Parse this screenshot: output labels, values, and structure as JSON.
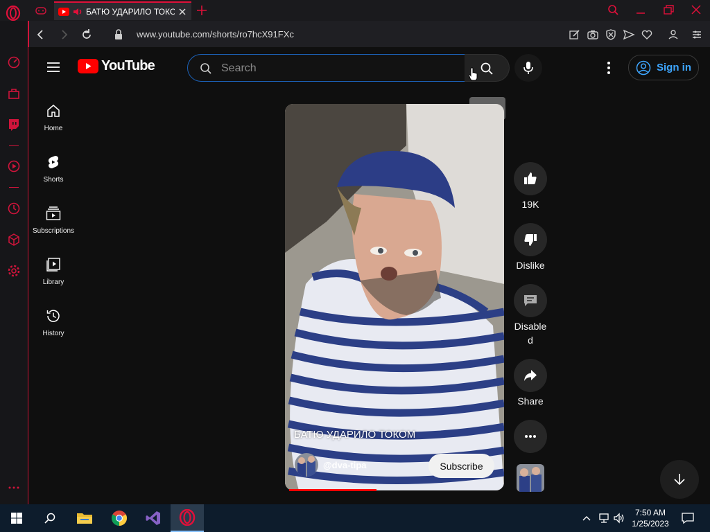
{
  "browser": {
    "tab_title": "БАТЮ УДАРИЛО ТОКОМ",
    "address": "www.youtube.com/shorts/ro7hcX91FXc"
  },
  "youtube": {
    "logo_text": "YouTube",
    "search": {
      "placeholder": "Search",
      "value": ""
    },
    "tooltip": "Search",
    "signin_label": "Sign in",
    "nav": [
      {
        "label": "Home",
        "icon": "home-icon"
      },
      {
        "label": "Shorts",
        "icon": "shorts-icon"
      },
      {
        "label": "Subscriptions",
        "icon": "subscriptions-icon"
      },
      {
        "label": "Library",
        "icon": "library-icon"
      },
      {
        "label": "History",
        "icon": "history-icon"
      }
    ],
    "video": {
      "title": "БАТЮ УДАРИЛО ТОКОМ",
      "channel": "@dva-tipa",
      "subscribe_label": "Subscribe"
    },
    "actions": {
      "like_count": "19K",
      "dislike_label": "Dislike",
      "comments_label_1": "Disable",
      "comments_label_2": "d",
      "share_label": "Share"
    }
  },
  "taskbar": {
    "time": "7:50 AM",
    "date": "1/25/2023"
  },
  "colors": {
    "opera_accent": "#d0143b",
    "yt_red": "#ff0000",
    "signin_blue": "#3ea6ff"
  }
}
